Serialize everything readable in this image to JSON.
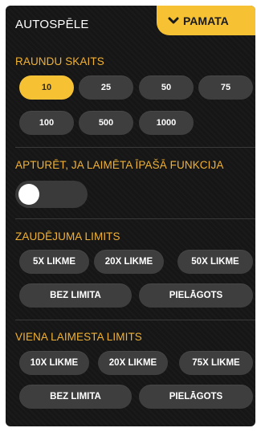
{
  "header": {
    "title": "AUTOSPĒLE",
    "mode_tab": "PAMATA"
  },
  "rounds": {
    "label": "RAUNDU SKAITS",
    "options": [
      "10",
      "25",
      "50",
      "75",
      "100",
      "500",
      "1000"
    ],
    "selected": "10"
  },
  "stop_feature": {
    "label": "APTURĒT, JA LAIMĒTA ĪPAŠĀ FUNKCIJA",
    "toggle_on": false
  },
  "loss_limit": {
    "label": "ZAUDĒJUMA LIMITS",
    "options": [
      "5X LIKME",
      "20X LIKME",
      "50X LIKME",
      "BEZ LIMITA",
      "PIELĀGOTS"
    ]
  },
  "single_win_limit": {
    "label": "VIENA LAIMESTA LIMITS",
    "options": [
      "10X LIKME",
      "20X LIKME",
      "75X LIKME",
      "BEZ LIMITA",
      "PIELĀGOTS"
    ]
  },
  "colors": {
    "accent": "#f6c133",
    "label": "#f2b233",
    "panel": "#161616",
    "pill": "#3e3e3e"
  }
}
